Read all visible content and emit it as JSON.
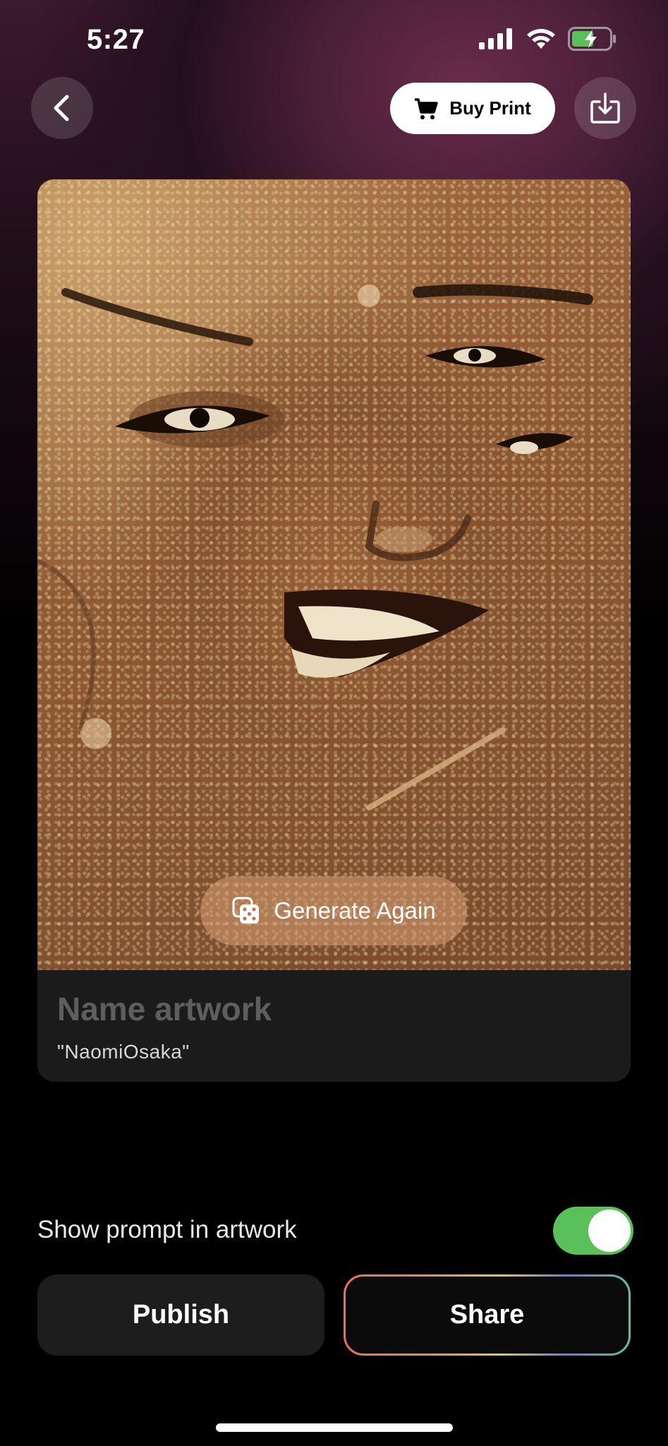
{
  "status_bar": {
    "time": "5:27",
    "icons": [
      "cellular-signal-icon",
      "wifi-icon",
      "battery-charging-icon"
    ]
  },
  "nav": {
    "back_icon": "chevron-left-icon",
    "buy_print_label": "Buy Print",
    "buy_print_icon": "cart-icon",
    "save_icon": "download-icon"
  },
  "artwork": {
    "generate_again_label": "Generate Again",
    "generate_again_icon": "dice-icon"
  },
  "name_field": {
    "placeholder": "Name artwork",
    "value": "",
    "prompt": "\"NaomiOsaka\""
  },
  "options": {
    "show_prompt_label": "Show prompt in artwork",
    "show_prompt_enabled": true,
    "toggle_color": "#5ac05a"
  },
  "actions": {
    "publish_label": "Publish",
    "share_label": "Share"
  }
}
